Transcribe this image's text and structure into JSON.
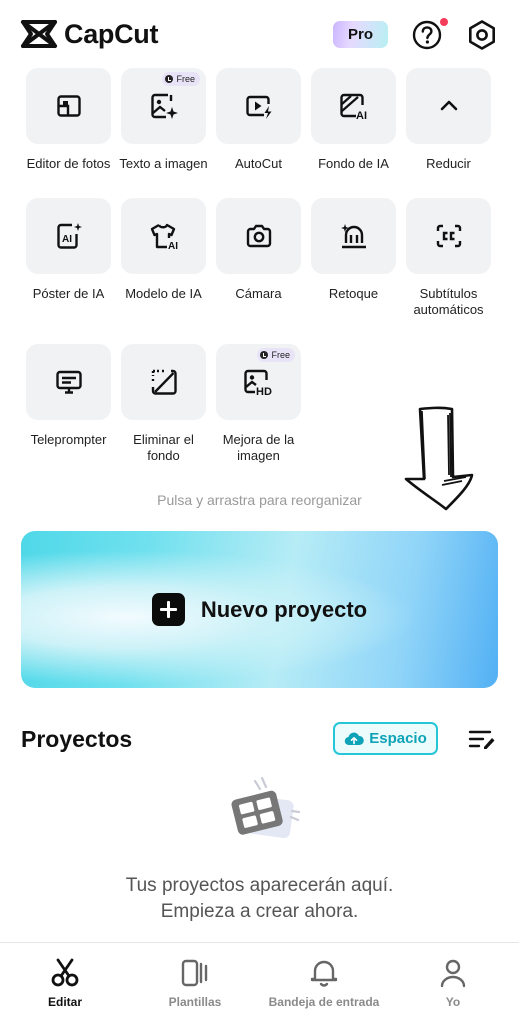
{
  "header": {
    "app_name": "CapCut",
    "pro_label": "Pro",
    "help_icon": "help-circle-icon",
    "settings_icon": "settings-hexagon-icon",
    "notification_dot_color": "#f53d5b"
  },
  "tools": [
    {
      "label": "Editor de fotos",
      "icon": "photo-editor-icon"
    },
    {
      "label": "Texto a imagen",
      "icon": "text-to-image-icon",
      "badge": "Free"
    },
    {
      "label": "AutoCut",
      "icon": "autocut-icon"
    },
    {
      "label": "Fondo de IA",
      "icon": "ai-background-icon"
    },
    {
      "label": "Reducir",
      "icon": "chevron-up-icon"
    },
    {
      "label": "Póster de IA",
      "icon": "ai-poster-icon"
    },
    {
      "label": "Modelo de IA",
      "icon": "ai-model-icon"
    },
    {
      "label": "Cámara",
      "icon": "camera-icon"
    },
    {
      "label": "Retoque",
      "icon": "retouch-icon"
    },
    {
      "label": "Subtítulos automáticos",
      "icon": "auto-captions-icon"
    },
    {
      "label": "Teleprompter",
      "icon": "teleprompter-icon"
    },
    {
      "label": "Eliminar el fondo",
      "icon": "remove-background-icon"
    },
    {
      "label": "Mejora de la imagen",
      "icon": "image-enhance-icon",
      "badge": "Free"
    }
  ],
  "hint": "Pulsa y arrastra para reorganizar",
  "new_project": {
    "label": "Nuevo proyecto"
  },
  "projects": {
    "title": "Proyectos",
    "space_label": "Espacio",
    "empty_line1": "Tus proyectos aparecerán aquí.",
    "empty_line2": "Empieza a crear ahora."
  },
  "nav": [
    {
      "label": "Editar",
      "icon": "scissors-icon",
      "active": true
    },
    {
      "label": "Plantillas",
      "icon": "templates-icon",
      "active": false
    },
    {
      "label": "Bandeja de entrada",
      "icon": "bell-icon",
      "active": false
    },
    {
      "label": "Yo",
      "icon": "profile-icon",
      "active": false
    }
  ],
  "colors": {
    "accent": "#25c6d8",
    "tile_bg": "#f1f2f4",
    "text_dark": "#111111",
    "text_muted": "#999999"
  }
}
